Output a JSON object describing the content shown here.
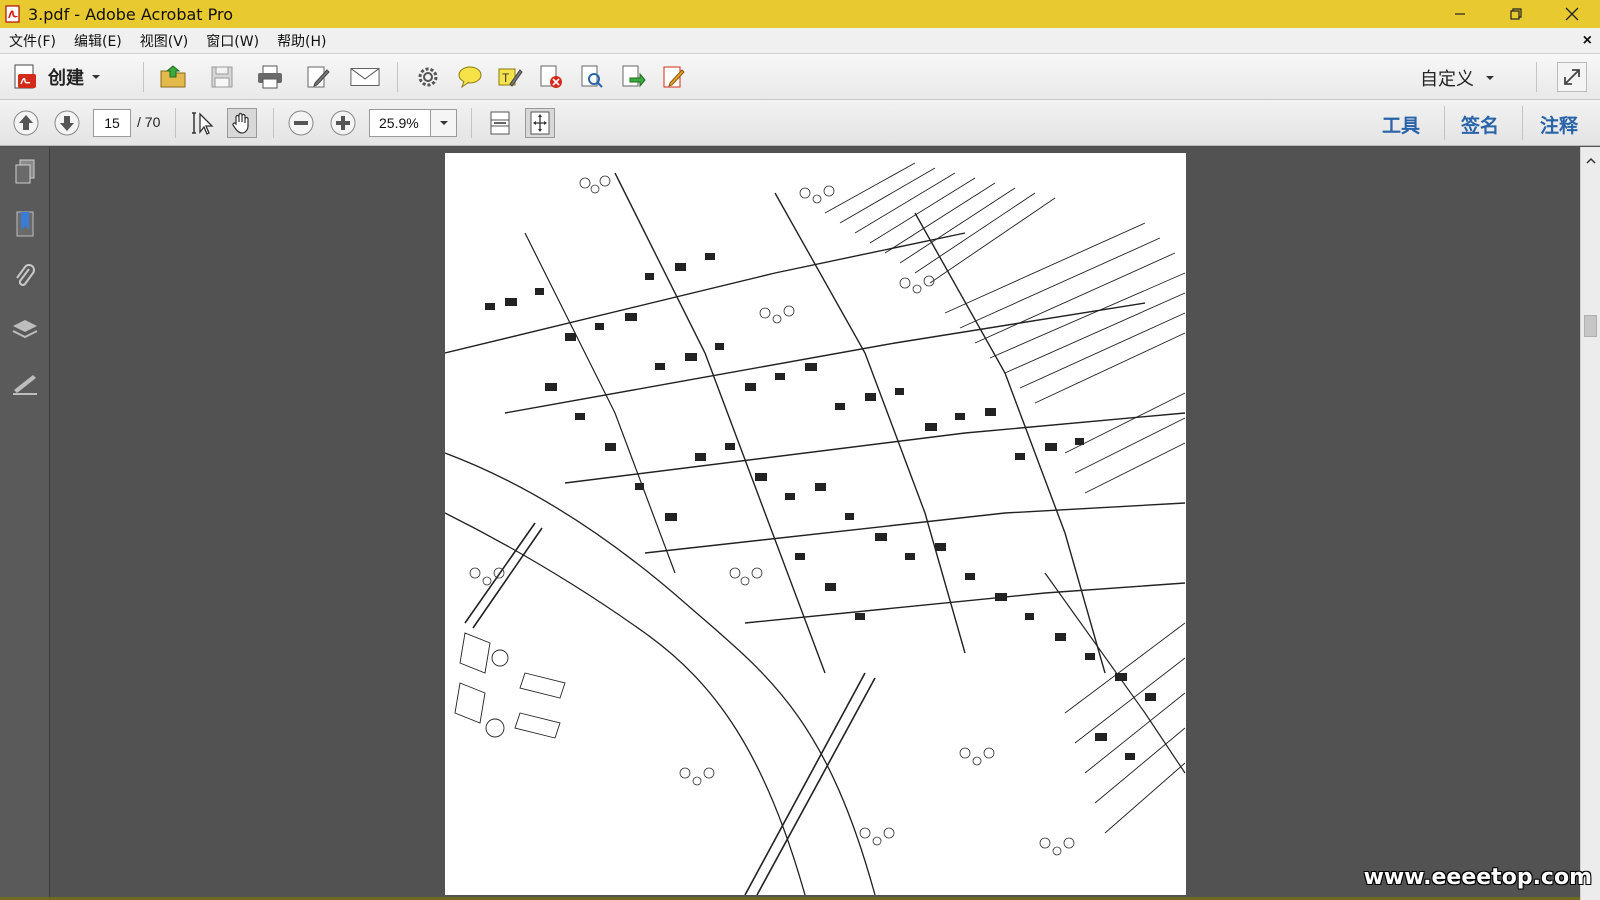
{
  "window": {
    "title": "3.pdf - Adobe Acrobat Pro"
  },
  "menu": {
    "items": [
      "文件(F)",
      "编辑(E)",
      "视图(V)",
      "窗口(W)",
      "帮助(H)"
    ],
    "close_glyph": "×"
  },
  "toolbar": {
    "create_label": "创建",
    "customize_label": "自定义",
    "icons": [
      "open-icon",
      "save-icon",
      "print-icon",
      "edit-icon",
      "email-icon",
      "settings-icon",
      "comment-icon",
      "highlight-icon",
      "pdf-delete-icon",
      "pdf-search-icon",
      "export-icon",
      "sign-edit-icon"
    ]
  },
  "navigation": {
    "current_page": "15",
    "total_pages": "/ 70",
    "zoom": "25.9%"
  },
  "panes": {
    "tools": "工具",
    "sign": "签名",
    "comment": "注释"
  },
  "watermark": "www.eeeetop.com",
  "colors": {
    "titlebar": "#e8c92f",
    "doc_background": "#525252",
    "pane_link": "#2a64a8"
  }
}
